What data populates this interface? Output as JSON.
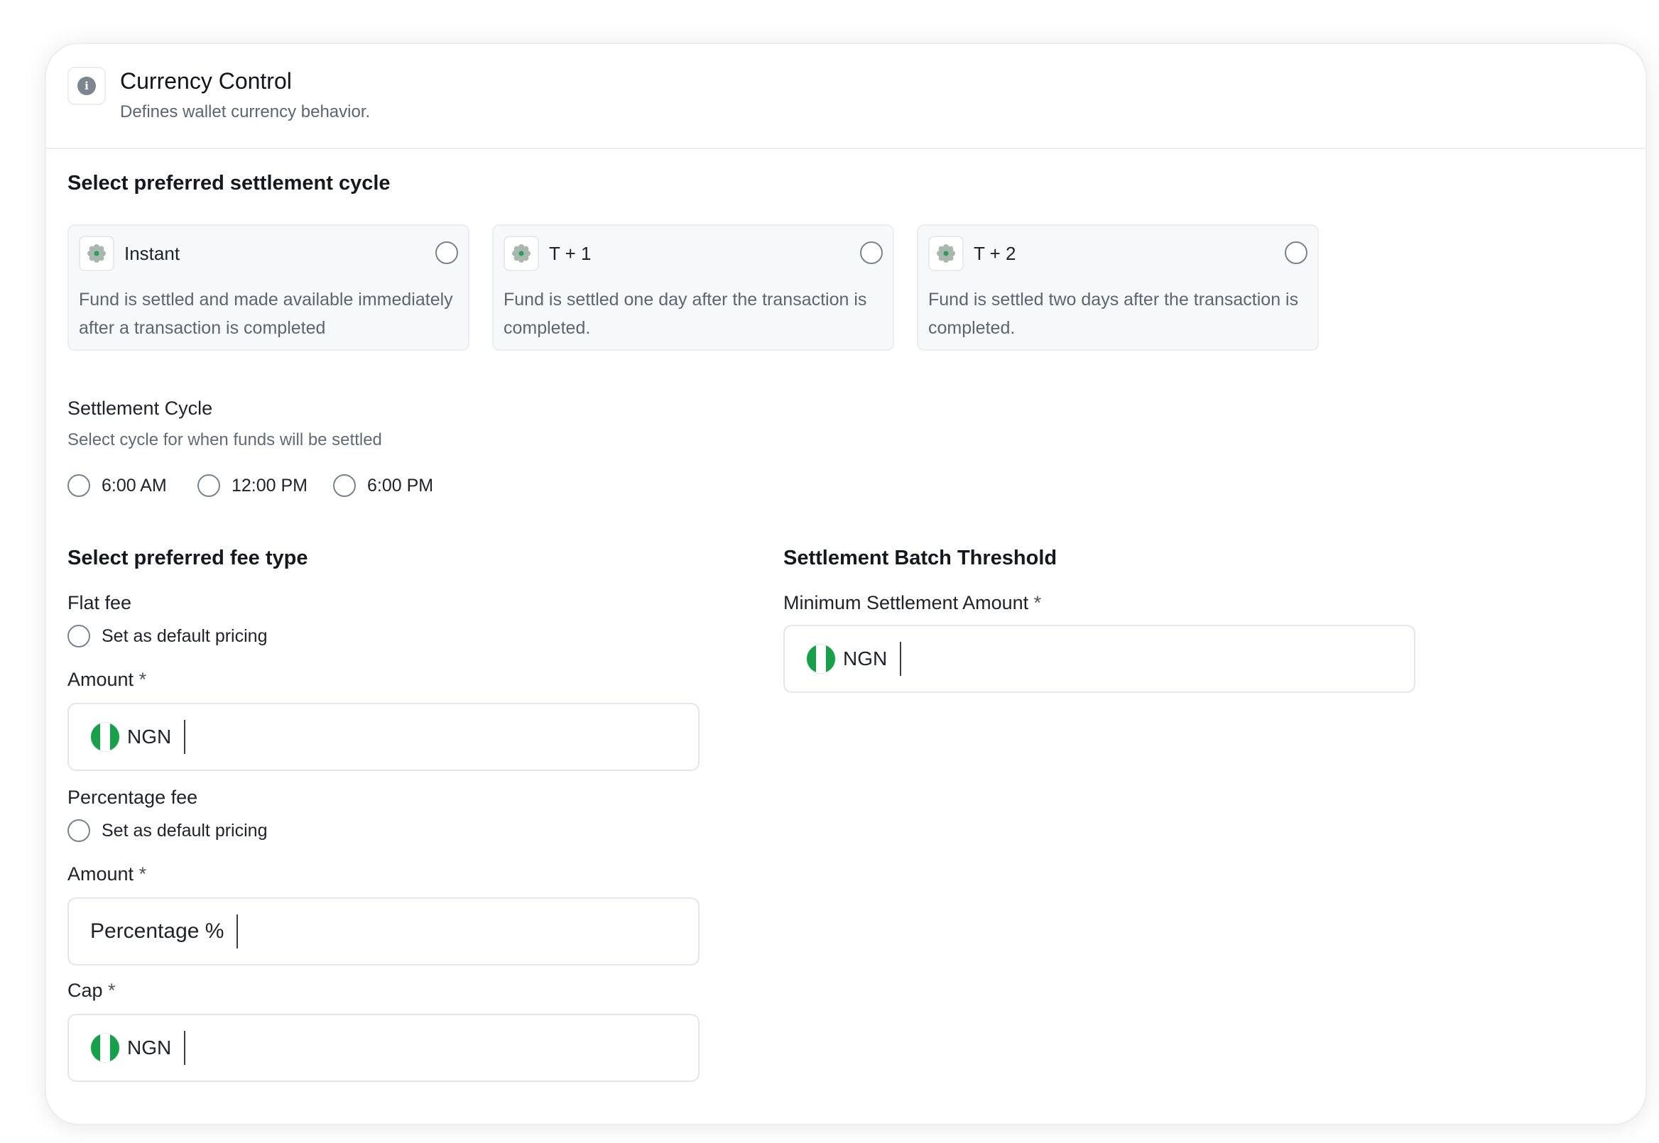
{
  "header": {
    "title": "Currency Control",
    "subtitle": "Defines wallet currency behavior."
  },
  "settlement": {
    "section_title": "Select preferred settlement cycle",
    "options": [
      {
        "title": "Instant",
        "description": "Fund is settled and made available immediately after a transaction is completed",
        "selected": false
      },
      {
        "title": "T + 1",
        "description": "Fund is settled one day after the transaction is completed.",
        "selected": false
      },
      {
        "title": "T + 2",
        "description": "Fund is settled two days after the transaction is completed.",
        "selected": false
      }
    ]
  },
  "cycle": {
    "label": "Settlement Cycle",
    "helper": "Select cycle for when funds will be settled",
    "times": [
      "6:00 AM",
      "12:00 PM",
      "6:00 PM"
    ]
  },
  "fee": {
    "section_title": "Select preferred fee type",
    "flat": {
      "label": "Flat fee",
      "default_label": "Set as default pricing",
      "amount_label": "Amount",
      "currency": "NGN"
    },
    "percentage": {
      "label": "Percentage fee",
      "default_label": "Set as default pricing",
      "amount_label": "Amount",
      "amount_placeholder": "Percentage %",
      "cap_label": "Cap",
      "cap_currency": "NGN"
    },
    "required_mark": "*"
  },
  "threshold": {
    "section_title": "Settlement Batch Threshold",
    "min_label": "Minimum Settlement Amount",
    "currency": "NGN"
  },
  "colors": {
    "flag_green": "#16a04a",
    "muted_text": "#5d6570",
    "border": "#e3e6ea"
  },
  "icons": {
    "header": "info-icon",
    "option": "settings-gear-icon",
    "currency": "nigeria-flag-icon"
  }
}
